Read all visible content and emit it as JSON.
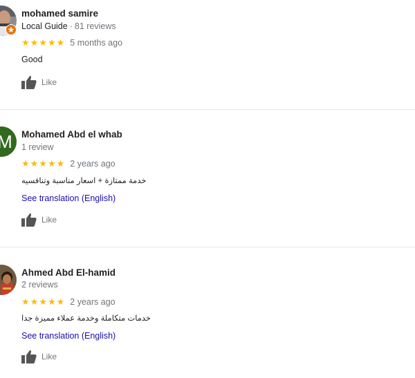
{
  "reviews": [
    {
      "name": "mohamed samire",
      "guide_label": "Local Guide",
      "separator": "·",
      "review_count": "81 reviews",
      "stars": "★★★★★",
      "rating": 5,
      "time": "5 months ago",
      "text": "Good",
      "like_label": "Like",
      "avatar_icon": "person-photo"
    },
    {
      "name": "Mohamed Abd el whab",
      "review_count": "1 review",
      "stars": "★★★★★",
      "rating": 5,
      "time": "2 years ago",
      "text": "خدمة ممتازة + اسعار مناسبة وتنافسيه",
      "translate_label": "See translation (English)",
      "like_label": "Like",
      "avatar_letter": "M",
      "avatar_color": "#33691e"
    },
    {
      "name": "Ahmed Abd El-hamid",
      "review_count": "2 reviews",
      "stars": "★★★★★",
      "rating": 5,
      "time": "2 years ago",
      "text": "خدمات متكاملة وخدمة عملاء مميزة جدا",
      "translate_label": "See translation (English)",
      "like_label": "Like",
      "avatar_icon": "person-photo"
    }
  ],
  "colors": {
    "star": "#fbbc04",
    "link": "#1a0dab",
    "muted": "#70757a",
    "badge": "#e8710a"
  }
}
